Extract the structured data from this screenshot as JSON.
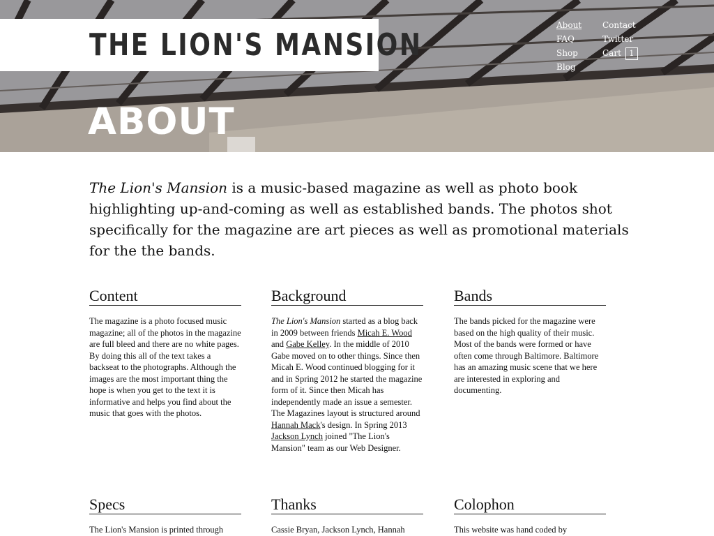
{
  "header": {
    "logo_text": "THE LION'S MANSION",
    "page_title": "ABOUT"
  },
  "nav": {
    "left": [
      {
        "label": "About",
        "active": true
      },
      {
        "label": "FAQ"
      },
      {
        "label": "Shop"
      },
      {
        "label": "Blog"
      }
    ],
    "right": [
      {
        "label": "Contact"
      },
      {
        "label": "Twitter"
      },
      {
        "label": "Cart",
        "count": "1"
      }
    ]
  },
  "intro": {
    "title_italic": "The Lion's Mansion",
    "text": " is a music-based magazine as well as photo book highlighting up-and-coming as well as established bands. The photos shot specifically for the magazine are art pieces as well as promotional materials for the the bands."
  },
  "sections": {
    "content": {
      "heading": "Content",
      "body": "The magazine is a photo focused music magazine; all of the photos in the magazine are full bleed and there are no white pages. By doing this all of the text takes a backseat to the photographs. Although the images are the most important thing the hope is when you get to the text it is informative and helps you find about the music that goes with the photos."
    },
    "background": {
      "heading": "Background",
      "italic": "The Lion's Mansion",
      "t1": " started as a blog back in 2009 between friends ",
      "link1": "Micah E. Wood",
      "t2": " and ",
      "link2": "Gabe Kelley",
      "t3": ". In the middle of 2010 Gabe moved on to other things. Since then Micah E. Wood continued blogging for it and in Spring 2012 he started the magazine form of it. Since then Micah has independently made an issue a semester. The Magazines layout is structured around ",
      "link3": "Hannah Mack",
      "t4": "'s design. In Spring 2013 ",
      "link4": "Jackson Lynch",
      "t5": " joined \"The Lion's Mansion\" team as our Web Designer."
    },
    "bands": {
      "heading": "Bands",
      "body": "The bands picked for the magazine were based on the high quality of their music. Most of the bands were formed or have often come through Baltimore. Baltimore has an amazing music scene that we here are interested in exploring and documenting."
    },
    "specs": {
      "heading": "Specs",
      "body": "The Lion's Mansion is printed through"
    },
    "thanks": {
      "heading": "Thanks",
      "body": "Cassie Bryan, Jackson Lynch, Hannah"
    },
    "colophon": {
      "heading": "Colophon",
      "body": "This website was hand coded by"
    }
  }
}
